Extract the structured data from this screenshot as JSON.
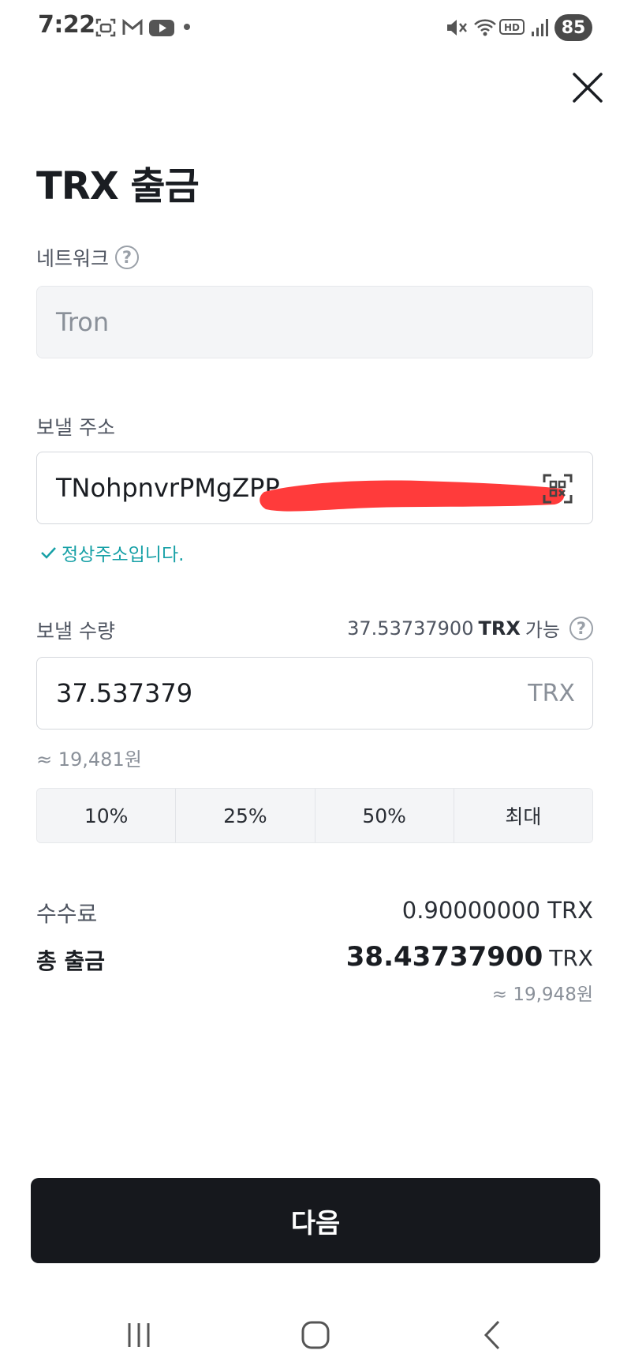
{
  "status_bar": {
    "time": "7:22",
    "battery": "85",
    "left_icons": [
      "screenshot-icon",
      "gmail-icon",
      "youtube-icon",
      "notification-dot-icon"
    ],
    "right_icons": [
      "mute-icon",
      "wifi-icon",
      "hd-voice-icon",
      "signal-icon"
    ]
  },
  "header": {
    "title": "TRX 출금",
    "close_icon": "close-icon"
  },
  "network": {
    "label": "네트워크",
    "value": "Tron"
  },
  "address": {
    "label": "보낼 주소",
    "value": "TNohpnvrPMgZPP",
    "redaction_color": "#ff3b3b",
    "valid_text": "정상주소입니다."
  },
  "amount": {
    "label": "보낼 수량",
    "available_amount": "37.53737900",
    "available_unit": "TRX",
    "available_suffix": "가능",
    "value": "37.537379",
    "unit": "TRX",
    "krw_estimate": "≈ 19,481원"
  },
  "percent_buttons": [
    "10%",
    "25%",
    "50%",
    "최대"
  ],
  "summary": {
    "fee_label": "수수료",
    "fee_value": "0.90000000 TRX",
    "total_label": "총 출금",
    "total_amount": "38.43737900",
    "total_unit": "TRX",
    "total_krw": "≈ 19,948원"
  },
  "next_button": "다음",
  "colors": {
    "accent_valid": "#16a0a6",
    "button_bg": "#16181d"
  },
  "nav_bar": [
    "recent-apps-icon",
    "home-icon",
    "back-icon"
  ]
}
